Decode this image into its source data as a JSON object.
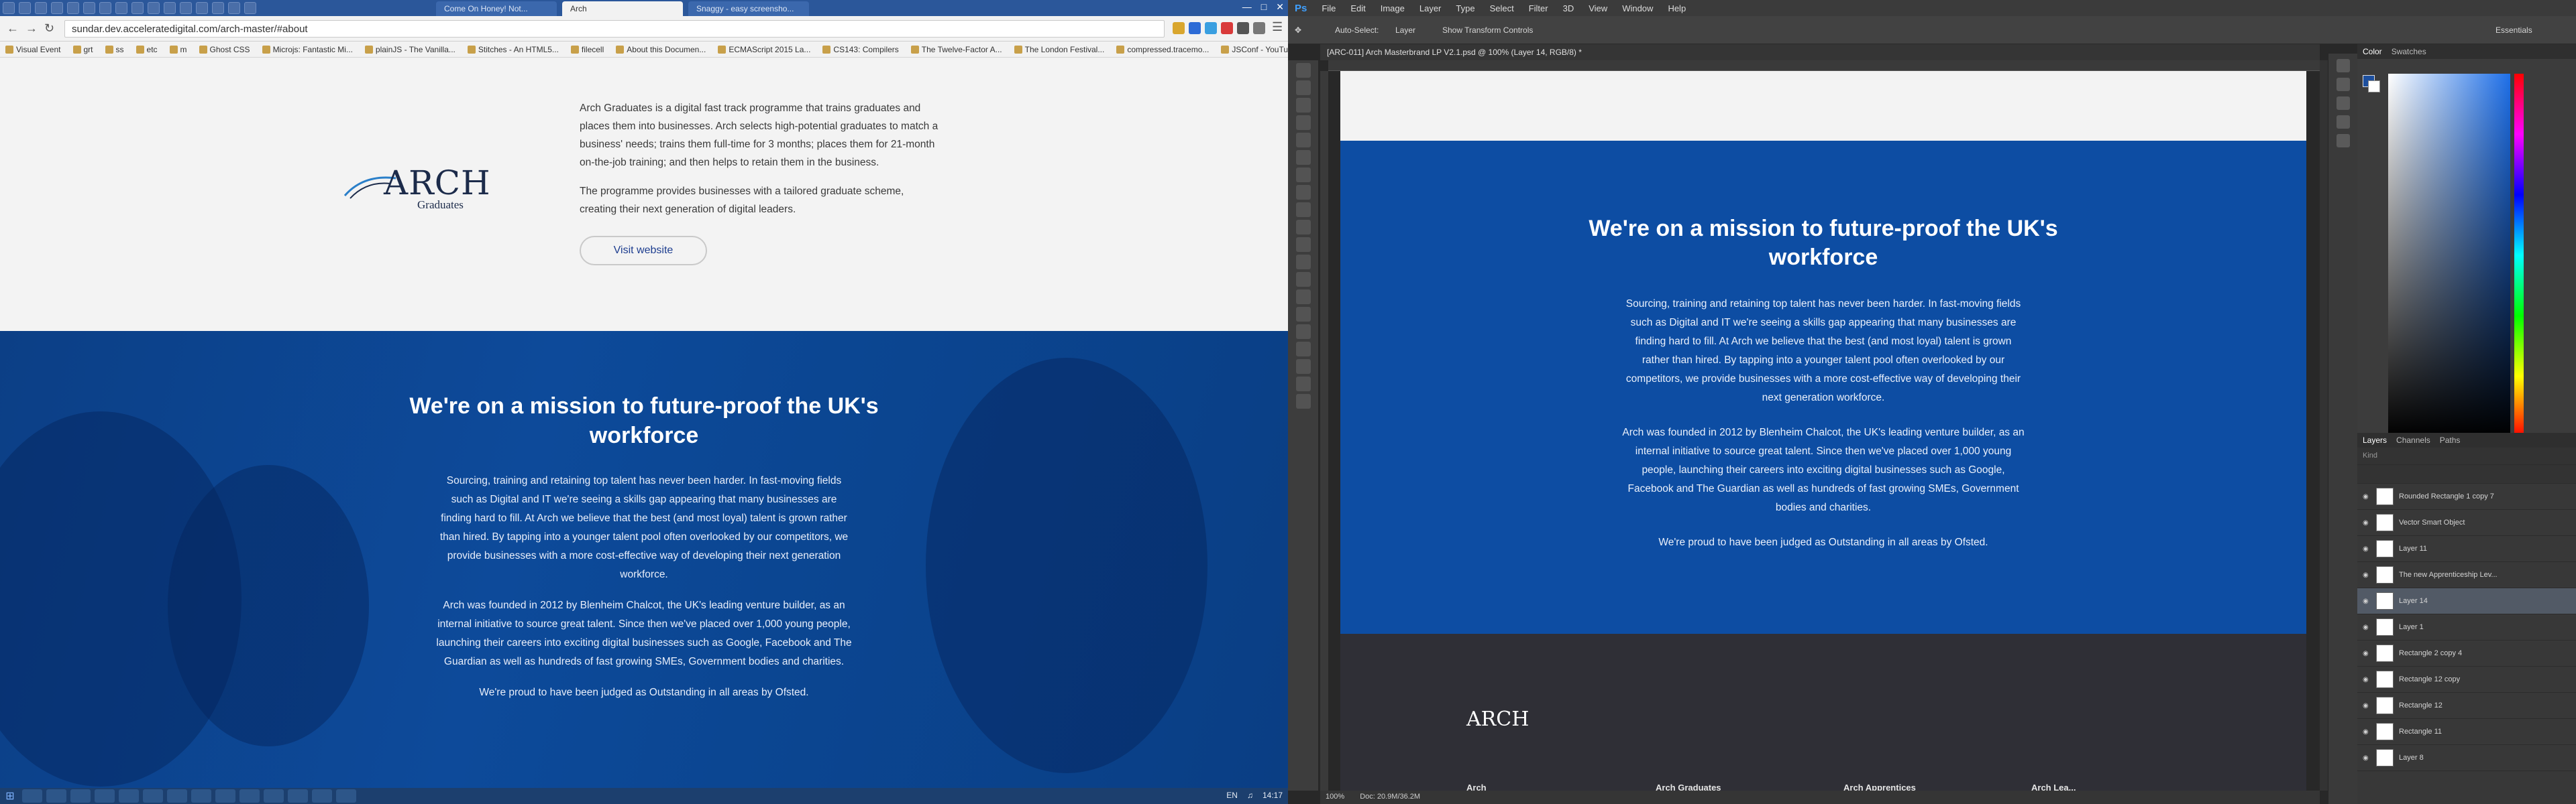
{
  "browser": {
    "tabs": [
      {
        "label": "Come On Honey! Not..."
      },
      {
        "label": "Arch"
      },
      {
        "label": "Snaggy - easy screensho..."
      }
    ],
    "url": "sundar.dev.acceleratedigital.com/arch-master/#about",
    "bookmarks": [
      "Visual Event",
      "grt",
      "ss",
      "etc",
      "m",
      "Ghost CSS",
      "Microjs: Fantastic Mi...",
      "plainJS - The Vanilla...",
      "Stitches - An HTML5...",
      "filecell",
      "About this Documen...",
      "ECMAScript 2015 La...",
      "CS143: Compilers",
      "The Twelve-Factor A...",
      "The London Festival...",
      "compressed.tracemo...",
      "JSConf - YouTube"
    ],
    "graduates": {
      "logo_word": "ARCH",
      "logo_sub": "Graduates",
      "p1": "Arch Graduates is a digital fast track programme that trains graduates and places them into businesses. Arch selects high-potential graduates to match a business' needs; trains them full-time for 3 months; places them for 21-month on-the-job training; and then helps to retain them in the business.",
      "p2": "The programme provides businesses with a tailored graduate scheme, creating their next generation of digital leaders.",
      "button": "Visit website"
    },
    "mission": {
      "title": "We're on a mission to future-proof the UK's workforce",
      "p1": "Sourcing, training and retaining top talent has never been harder. In fast-moving fields such as Digital and IT we're seeing a skills gap appearing that many businesses are finding hard to fill. At Arch we believe that the best (and most loyal) talent is grown rather than hired. By tapping into a younger talent pool often overlooked by our competitors, we provide businesses with a more cost-effective way of developing their next generation workforce.",
      "p2": "Arch was founded in 2012 by Blenheim Chalcot, the UK's leading venture builder, as an internal initiative to source great talent. Since then we've placed over 1,000 young people, launching their careers into exciting digital businesses such as Google, Facebook and The Guardian as well as hundreds of fast growing SMEs, Government bodies and charities.",
      "p3": "We're proud to have been judged as Outstanding in all areas by Ofsted."
    },
    "taskbar": {
      "lang": "EN",
      "time": "14:17"
    }
  },
  "photoshop": {
    "menu": [
      "File",
      "Edit",
      "Image",
      "Layer",
      "Type",
      "Select",
      "Filter",
      "3D",
      "View",
      "Window",
      "Help"
    ],
    "options": {
      "auto_select": "Auto-Select:",
      "auto_select_value": "Layer",
      "show_transform": "Show Transform Controls",
      "workspace": "Essentials"
    },
    "doc_tab": "[ARC-011] Arch Masterbrand LP V2.1.psd @ 100% (Layer 14, RGB/8) *",
    "status_zoom": "100%",
    "status_doc": "Doc: 20.9M/36.2M",
    "artboard": {
      "title": "We're on a mission to future-proof the UK's workforce",
      "p1": "Sourcing, training and retaining top talent has never been harder. In fast-moving fields such as Digital and IT we're seeing a skills gap appearing that many businesses are finding hard to fill. At Arch we believe that the best (and most loyal) talent is grown rather than hired. By tapping into a younger talent pool often overlooked by our competitors, we provide businesses with a more cost-effective way of developing their next generation workforce.",
      "p2": "Arch was founded in 2012 by Blenheim Chalcot, the UK's leading venture builder, as an internal initiative to source great talent. Since then we've placed over 1,000 young people, launching their careers into exciting digital businesses such as Google, Facebook and The Guardian as well as hundreds of fast growing SMEs, Government bodies and charities.",
      "p3": "We're proud to have been judged as Outstanding in all areas by Ofsted.",
      "footer_logo": "ARCH",
      "footer_cols": [
        "Arch",
        "Arch Graduates",
        "Arch Apprentices",
        "Arch Lea..."
      ]
    },
    "panels": {
      "color_tabs": [
        "Color",
        "Swatches"
      ],
      "layer_tabs": [
        "Layers",
        "Channels",
        "Paths"
      ],
      "kind": "Kind",
      "layers": [
        "Rounded Rectangle 1 copy 7",
        "Vector Smart Object",
        "Layer 11",
        "The new Apprenticeship Lev...",
        "Layer 14",
        "Layer 1",
        "Rectangle 2 copy 4",
        "Rectangle 12 copy",
        "Rectangle 12",
        "Rectangle 11",
        "Layer 8"
      ],
      "selected_layer": "Layer 14"
    }
  }
}
